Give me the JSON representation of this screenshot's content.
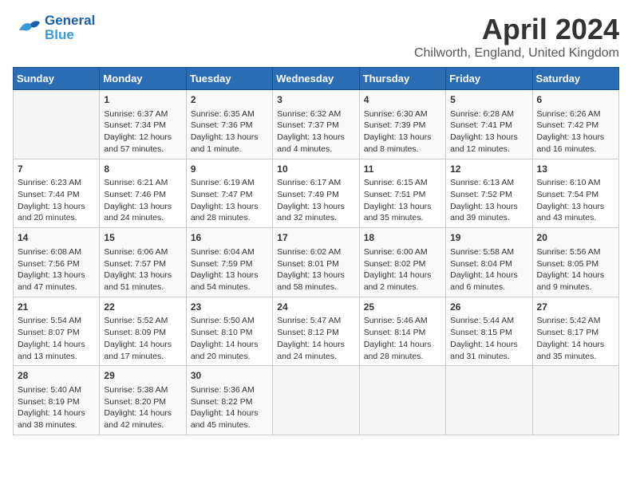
{
  "header": {
    "logo_general": "General",
    "logo_blue": "Blue",
    "title": "April 2024",
    "subtitle": "Chilworth, England, United Kingdom"
  },
  "days_of_week": [
    "Sunday",
    "Monday",
    "Tuesday",
    "Wednesday",
    "Thursday",
    "Friday",
    "Saturday"
  ],
  "weeks": [
    [
      {
        "num": "",
        "info": ""
      },
      {
        "num": "1",
        "info": "Sunrise: 6:37 AM\nSunset: 7:34 PM\nDaylight: 12 hours\nand 57 minutes."
      },
      {
        "num": "2",
        "info": "Sunrise: 6:35 AM\nSunset: 7:36 PM\nDaylight: 13 hours\nand 1 minute."
      },
      {
        "num": "3",
        "info": "Sunrise: 6:32 AM\nSunset: 7:37 PM\nDaylight: 13 hours\nand 4 minutes."
      },
      {
        "num": "4",
        "info": "Sunrise: 6:30 AM\nSunset: 7:39 PM\nDaylight: 13 hours\nand 8 minutes."
      },
      {
        "num": "5",
        "info": "Sunrise: 6:28 AM\nSunset: 7:41 PM\nDaylight: 13 hours\nand 12 minutes."
      },
      {
        "num": "6",
        "info": "Sunrise: 6:26 AM\nSunset: 7:42 PM\nDaylight: 13 hours\nand 16 minutes."
      }
    ],
    [
      {
        "num": "7",
        "info": "Sunrise: 6:23 AM\nSunset: 7:44 PM\nDaylight: 13 hours\nand 20 minutes."
      },
      {
        "num": "8",
        "info": "Sunrise: 6:21 AM\nSunset: 7:46 PM\nDaylight: 13 hours\nand 24 minutes."
      },
      {
        "num": "9",
        "info": "Sunrise: 6:19 AM\nSunset: 7:47 PM\nDaylight: 13 hours\nand 28 minutes."
      },
      {
        "num": "10",
        "info": "Sunrise: 6:17 AM\nSunset: 7:49 PM\nDaylight: 13 hours\nand 32 minutes."
      },
      {
        "num": "11",
        "info": "Sunrise: 6:15 AM\nSunset: 7:51 PM\nDaylight: 13 hours\nand 35 minutes."
      },
      {
        "num": "12",
        "info": "Sunrise: 6:13 AM\nSunset: 7:52 PM\nDaylight: 13 hours\nand 39 minutes."
      },
      {
        "num": "13",
        "info": "Sunrise: 6:10 AM\nSunset: 7:54 PM\nDaylight: 13 hours\nand 43 minutes."
      }
    ],
    [
      {
        "num": "14",
        "info": "Sunrise: 6:08 AM\nSunset: 7:56 PM\nDaylight: 13 hours\nand 47 minutes."
      },
      {
        "num": "15",
        "info": "Sunrise: 6:06 AM\nSunset: 7:57 PM\nDaylight: 13 hours\nand 51 minutes."
      },
      {
        "num": "16",
        "info": "Sunrise: 6:04 AM\nSunset: 7:59 PM\nDaylight: 13 hours\nand 54 minutes."
      },
      {
        "num": "17",
        "info": "Sunrise: 6:02 AM\nSunset: 8:01 PM\nDaylight: 13 hours\nand 58 minutes."
      },
      {
        "num": "18",
        "info": "Sunrise: 6:00 AM\nSunset: 8:02 PM\nDaylight: 14 hours\nand 2 minutes."
      },
      {
        "num": "19",
        "info": "Sunrise: 5:58 AM\nSunset: 8:04 PM\nDaylight: 14 hours\nand 6 minutes."
      },
      {
        "num": "20",
        "info": "Sunrise: 5:56 AM\nSunset: 8:05 PM\nDaylight: 14 hours\nand 9 minutes."
      }
    ],
    [
      {
        "num": "21",
        "info": "Sunrise: 5:54 AM\nSunset: 8:07 PM\nDaylight: 14 hours\nand 13 minutes."
      },
      {
        "num": "22",
        "info": "Sunrise: 5:52 AM\nSunset: 8:09 PM\nDaylight: 14 hours\nand 17 minutes."
      },
      {
        "num": "23",
        "info": "Sunrise: 5:50 AM\nSunset: 8:10 PM\nDaylight: 14 hours\nand 20 minutes."
      },
      {
        "num": "24",
        "info": "Sunrise: 5:47 AM\nSunset: 8:12 PM\nDaylight: 14 hours\nand 24 minutes."
      },
      {
        "num": "25",
        "info": "Sunrise: 5:46 AM\nSunset: 8:14 PM\nDaylight: 14 hours\nand 28 minutes."
      },
      {
        "num": "26",
        "info": "Sunrise: 5:44 AM\nSunset: 8:15 PM\nDaylight: 14 hours\nand 31 minutes."
      },
      {
        "num": "27",
        "info": "Sunrise: 5:42 AM\nSunset: 8:17 PM\nDaylight: 14 hours\nand 35 minutes."
      }
    ],
    [
      {
        "num": "28",
        "info": "Sunrise: 5:40 AM\nSunset: 8:19 PM\nDaylight: 14 hours\nand 38 minutes."
      },
      {
        "num": "29",
        "info": "Sunrise: 5:38 AM\nSunset: 8:20 PM\nDaylight: 14 hours\nand 42 minutes."
      },
      {
        "num": "30",
        "info": "Sunrise: 5:36 AM\nSunset: 8:22 PM\nDaylight: 14 hours\nand 45 minutes."
      },
      {
        "num": "",
        "info": ""
      },
      {
        "num": "",
        "info": ""
      },
      {
        "num": "",
        "info": ""
      },
      {
        "num": "",
        "info": ""
      }
    ]
  ]
}
